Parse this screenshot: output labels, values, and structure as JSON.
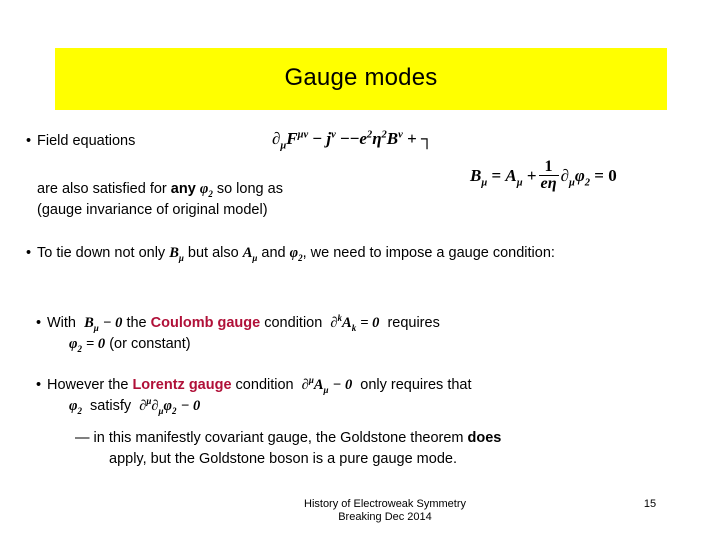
{
  "slide": {
    "title": "Gauge modes",
    "title_bg_color": "#ffff00",
    "accent_color": "#b01038",
    "background_color": "#ffffff"
  },
  "body": {
    "field_equations_label": "Field equations",
    "equation_field": {
      "lhs_del": "∂",
      "lhs_del_sub": "μ",
      "F": "F",
      "F_sup": "μν",
      "minus1": "−",
      "j": "j",
      "j_sup": "ν",
      "minus2": "−",
      "minus3": "−",
      "e": "e",
      "e_sup": "2",
      "eta": "η",
      "eta_sup": "2",
      "B": "B",
      "B_sup": "ν",
      "plus": "+",
      "trailing_glyph": "┐"
    },
    "satisfied_prefix": "are also satisfied for ",
    "satisfied_bold": "any",
    "satisfied_phi": "φ",
    "satisfied_phi_sub": "2",
    "satisfied_suffix": "so long as",
    "gauge_invariance_note": "(gauge invariance of original model)",
    "equation_gauge": {
      "B": "B",
      "B_sub": "μ",
      "equals1": "=",
      "A": "A",
      "A_sub": "μ",
      "plus": "+",
      "frac_num": "1",
      "frac_den_e": "e",
      "frac_den_eta": "η",
      "del": "∂",
      "del_sub": "μ",
      "phi": "φ",
      "phi_sub": "2",
      "equals2": "=",
      "zero": "0"
    },
    "tie_down": {
      "part1": "To tie down not only ",
      "B": "B",
      "B_sub": "μ",
      "part2": " but also ",
      "A": "A",
      "A_sub": "μ",
      "part3": " and ",
      "phi": "φ",
      "phi_sub": "2",
      "part4": ", we need to impose a gauge condition:"
    },
    "coulomb": {
      "part1": "With ",
      "B": "B",
      "B_sub": "μ",
      "minus_zero": "− 0",
      "part2": " the ",
      "gauge_name": "Coulomb gauge",
      "part3": " condition ",
      "del": "∂",
      "del_sup": "k",
      "A": "A",
      "A_sub": "k",
      "eq_zero": "= 0",
      "part4": "requires",
      "line2_phi": "φ",
      "line2_phi_sub": "2",
      "line2_eq": "= 0",
      "line2_rest": "(or constant)"
    },
    "lorentz": {
      "part1": "However the ",
      "gauge_name": "Lorentz gauge",
      "part2": " condition ",
      "del": "∂",
      "del_sup": "μ",
      "A": "A",
      "A_sub": "μ",
      "minus_zero": "− 0",
      "part3": "only requires that",
      "line2_phi": "φ",
      "line2_phi_sub": "2",
      "line2_satisfy": "satisfy",
      "line2_del1": "∂",
      "line2_del1_sup": "μ",
      "line2_del2": "∂",
      "line2_del2_sub": "μ",
      "line2_phi2": "φ",
      "line2_phi2_sub": "2",
      "line2_minus_zero": "− 0"
    },
    "covariant": {
      "dash": "—",
      "line1a": " in this manifestly covariant gauge, the Goldstone theorem ",
      "line1_bold": "does",
      "line2": "apply, but the Goldstone boson is a pure gauge mode."
    }
  },
  "footer": {
    "line1": "History of Electroweak Symmetry",
    "line2": "Breaking   Dec 2014",
    "page_number": "15"
  }
}
